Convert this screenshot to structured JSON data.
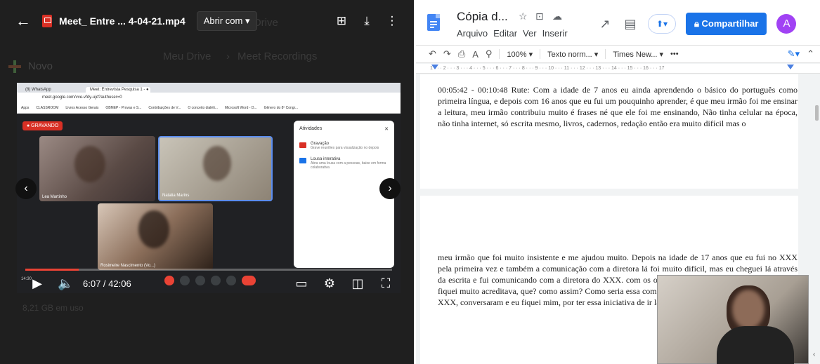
{
  "viewer": {
    "file_name": "Meet_ Entre ... 4-04-21.mp4",
    "open_with_label": "Abrir com",
    "open_with_caret": "▾",
    "back_icon": "arrow-left-icon",
    "add_shortcut_icon": "add-to-drive-icon",
    "download_icon": "download-icon",
    "more_icon": "more-vert-icon"
  },
  "drive_background": {
    "new_button": "Novo",
    "breadcrumb": [
      "Meu Drive",
      "Meet Recordings"
    ],
    "ghost_text": "no Drive",
    "storage": "8,21 GB em uso"
  },
  "video": {
    "current_time": "6:07",
    "duration": "42:06",
    "progress": 0.145,
    "time_separator": " / ",
    "recording_badge": "● GRAVANDO",
    "tabs": [
      "(8) WhatsApp",
      "Meet: Entrevista Pesquisa 1 - ●"
    ],
    "url": "meet.google.com/vve-vfdy-ujd?authuser=0",
    "bookmarks": [
      "Apps",
      "CLASSROOM",
      "Livros Acesso Gerais",
      "OBMEP - Provas e S...",
      "Contribuições de V...",
      "O conceito dialéti...",
      "Microsoft Word - D...",
      "Gênero do 8º Congr..."
    ],
    "participants": [
      "Lea Martinho",
      "Natalia Marins",
      "Rosimeire Nascimento (Vo...)"
    ],
    "panel": {
      "title": "Atividades",
      "items": [
        {
          "title": "Gravação",
          "desc": "Grave reuniões para visualização no depois"
        },
        {
          "title": "Lousa interativa",
          "desc": "Abra uma lousa com a pessoas, baixe em forma colaborativa"
        }
      ]
    },
    "clock": "14:30"
  },
  "docs": {
    "title": "Cópia d...",
    "menu": [
      "Arquivo",
      "Editar",
      "Ver",
      "Inserir"
    ],
    "share_label": "Compartilhar",
    "avatar_initial": "A",
    "toolbar": {
      "zoom": "100%",
      "style": "Texto norm...",
      "font": "Times New...",
      "more": "•••"
    },
    "ruler_numbers": [
      "1",
      "2",
      "3",
      "4",
      "5",
      "6",
      "7",
      "8",
      "9",
      "10",
      "11",
      "12",
      "13",
      "14",
      "15",
      "16",
      "17"
    ],
    "page1_text": "00:05:42 - 00:10:48 Rute: Com a idade de 7 anos eu ainda aprendendo o básico do português como primeira língua, e depois com 16 anos que eu fui um pouquinho aprender, é que meu irmão foi me ensinar a leitura, meu irmão contribuiu muito é frases né que ele foi me ensinando, Não tinha celular na época, não tinha internet, só escrita mesmo, livros, cadernos, redação então era muito difícil mas o",
    "page2_text": "meu irmão que foi muito insistente e me ajudou muito. Depois na idade de 17 anos que eu fui no XXX pela primeira vez e também a comunicação com a diretora lá foi muito difícil, mas eu cheguei lá através da escrita e fui comunicando com a diretora do XXX. com os ouvintes, aí a diretora do XXX aceitou eu fiquei muito acreditava, que? como assim? Como seria essa comunicação? eles foram juntos comigo lá no XXX, conversaram e eu fiquei mim, por ter essa iniciativa de ir lá."
  },
  "colors": {
    "share_blue": "#1a73e8",
    "record_red": "#d93025",
    "avatar_purple": "#a142f4"
  }
}
